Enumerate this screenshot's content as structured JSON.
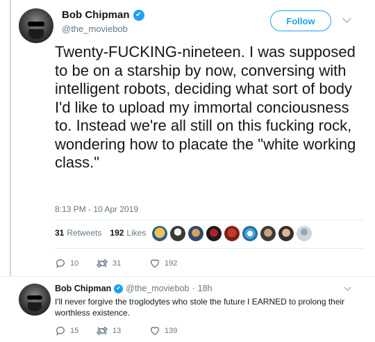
{
  "main_tweet": {
    "author_name": "Bob Chipman",
    "handle": "@the_moviebob",
    "follow_label": "Follow",
    "text": "Twenty-FUCKING-nineteen. I was supposed to be on a starship by now, conversing with intelligent robots, deciding what sort of body I'd like to upload my immortal conciousness to. Instead we're all still on this fucking rock, wondering how to placate the \"white working class.\"",
    "timestamp": "8:13 PM - 10 Apr 2019",
    "retweets_count": "31",
    "retweets_label": "Retweets",
    "likes_count": "192",
    "likes_label": "Likes",
    "liker_avatars": [
      "avatar-1",
      "avatar-2",
      "avatar-3",
      "avatar-4",
      "avatar-5",
      "avatar-6",
      "avatar-7",
      "avatar-8",
      "avatar-9"
    ],
    "actions": {
      "replies": "10",
      "retweets": "31",
      "likes": "192"
    }
  },
  "reply_tweet": {
    "author_name": "Bob Chipman",
    "handle": "@the_moviebob",
    "separator": "·",
    "time": "18h",
    "text": "I'll never forgive the troglodytes who stole the future I EARNED to prolong their worthless existence.",
    "actions": {
      "replies": "15",
      "retweets": "13",
      "likes": "139"
    }
  },
  "colors": {
    "accent": "#1da1f2",
    "muted": "#657786",
    "divider": "#e6ecf0",
    "thread_line": "#ccd6dd"
  }
}
